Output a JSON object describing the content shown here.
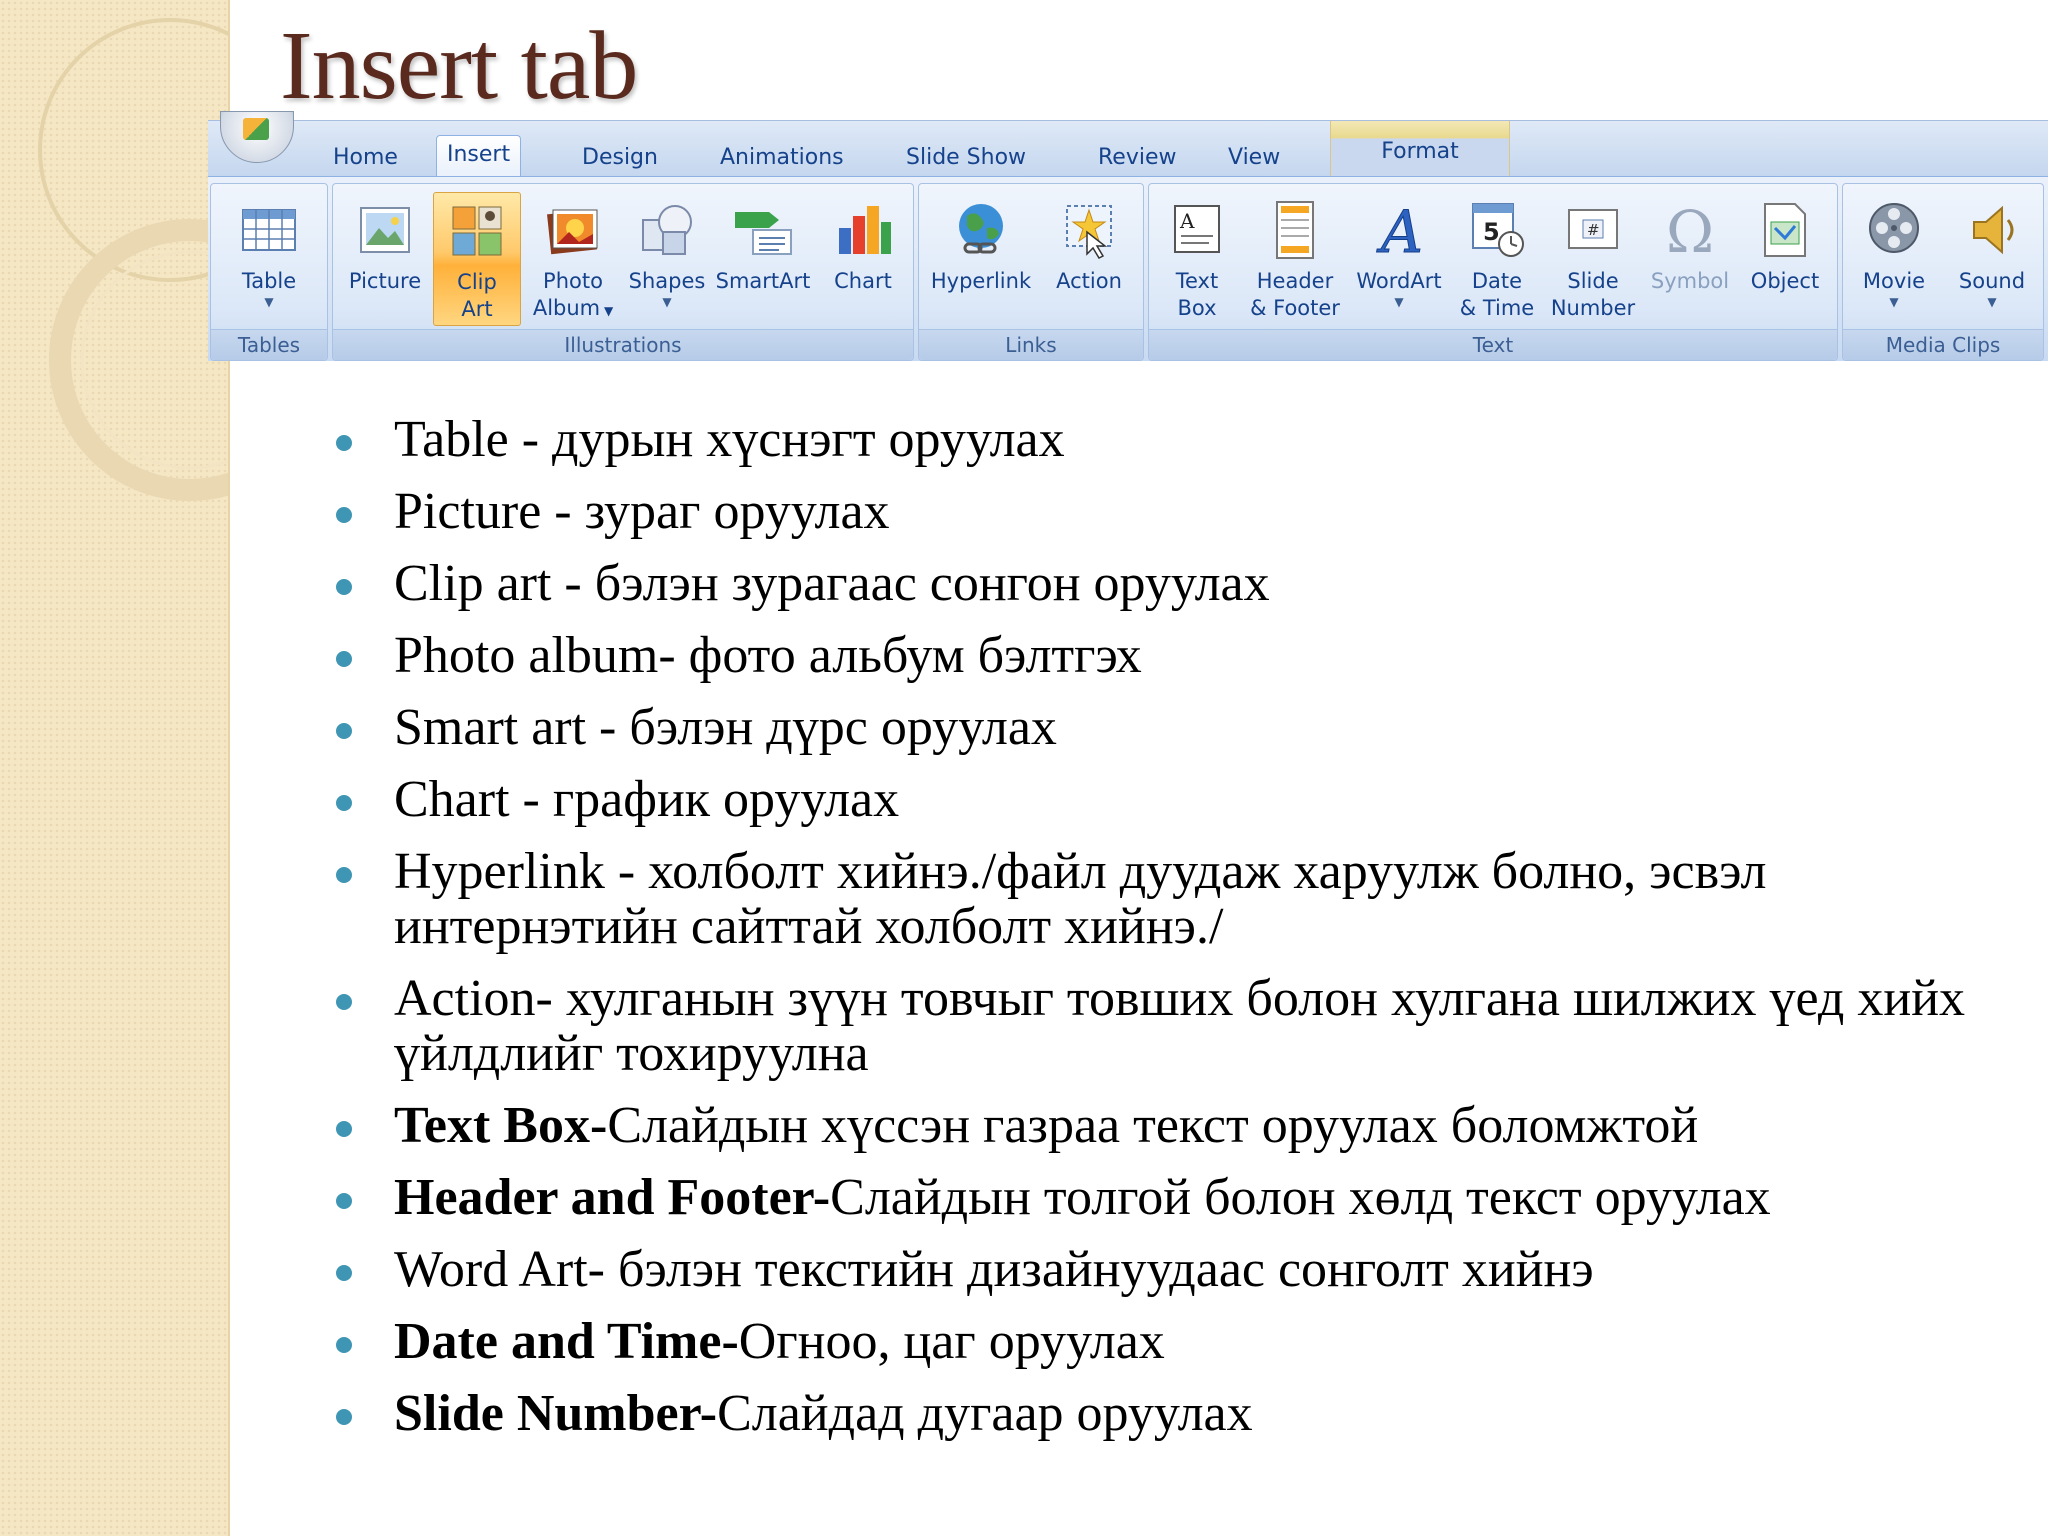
{
  "slide": {
    "title": "Insert tab"
  },
  "ribbon": {
    "tabs": [
      "Home",
      "Insert",
      "Design",
      "Animations",
      "Slide Show",
      "Review",
      "View",
      "Format"
    ],
    "active_tab": "Insert",
    "groups": {
      "tables": {
        "label": "Tables",
        "buttons": [
          {
            "label": "Table",
            "icon": "table-icon"
          }
        ]
      },
      "illustrations": {
        "label": "Illustrations",
        "buttons": [
          {
            "label": "Picture",
            "icon": "picture-icon"
          },
          {
            "label_1": "Clip",
            "label_2": "Art",
            "icon": "clip-art-icon",
            "selected": true
          },
          {
            "label_1": "Photo",
            "label_2": "Album",
            "icon": "photo-album-icon"
          },
          {
            "label": "Shapes",
            "icon": "shapes-icon"
          },
          {
            "label": "SmartArt",
            "icon": "smartart-icon"
          },
          {
            "label": "Chart",
            "icon": "chart-icon"
          }
        ]
      },
      "links": {
        "label": "Links",
        "buttons": [
          {
            "label": "Hyperlink",
            "icon": "globe-icon"
          },
          {
            "label": "Action",
            "icon": "action-star-icon"
          }
        ]
      },
      "text": {
        "label": "Text",
        "buttons": [
          {
            "label_1": "Text",
            "label_2": "Box",
            "icon": "text-box-icon"
          },
          {
            "label_1": "Header",
            "label_2": "& Footer",
            "icon": "header-footer-icon"
          },
          {
            "label": "WordArt",
            "icon": "wordart-icon"
          },
          {
            "label_1": "Date",
            "label_2": "& Time",
            "icon": "date-time-icon"
          },
          {
            "label_1": "Slide",
            "label_2": "Number",
            "icon": "slide-number-icon"
          },
          {
            "label": "Symbol",
            "icon": "omega-icon",
            "disabled": true
          },
          {
            "label": "Object",
            "icon": "object-icon"
          }
        ]
      },
      "media": {
        "label": "Media Clips",
        "buttons": [
          {
            "label": "Movie",
            "icon": "film-reel-icon"
          },
          {
            "label": "Sound",
            "icon": "speaker-icon"
          }
        ]
      }
    }
  },
  "bullets": [
    {
      "bold": "",
      "text": "Table - дурын хүснэгт оруулах"
    },
    {
      "bold": "",
      "text": "Picture - зураг оруулах"
    },
    {
      "bold": "",
      "text": "Clip art - бэлэн зурагаас сонгон оруулах"
    },
    {
      "bold": "",
      "text": "Photo album- фото альбум бэлтгэх"
    },
    {
      "bold": "",
      "text": "Smart art - бэлэн дүрс оруулах"
    },
    {
      "bold": "",
      "text": "Chart - график оруулах"
    },
    {
      "bold": "",
      "text": "Hyperlink - холболт хийнэ./файл дуудаж харуулж болно, эсвэл интернэтийн сайттай холболт хийнэ./"
    },
    {
      "bold": "",
      "text": "Action- хулганын зүүн товчыг товших болон хулгана шилжих үед хийх үйлдлийг тохируулна"
    },
    {
      "bold": "Text Box-",
      "text": "Слайдын хүссэн газраа текст оруулах боломжтой"
    },
    {
      "bold": "Header and Footer-",
      "text": "Слайдын толгой болон хөлд текст оруулах"
    },
    {
      "bold": "",
      "text": "Word Art- бэлэн текстийн дизайнуудаас сонголт хийнэ"
    },
    {
      "bold": "Date and Time-",
      "text": "Огноо, цаг оруулах"
    },
    {
      "bold": "Slide Number-",
      "text": "Слайдад дугаар оруулах"
    }
  ],
  "colors": {
    "title": "#5a2a1e",
    "bullet": "#3e96b4",
    "side_band": "#f5e6c4",
    "ribbon_text": "#15428b"
  }
}
